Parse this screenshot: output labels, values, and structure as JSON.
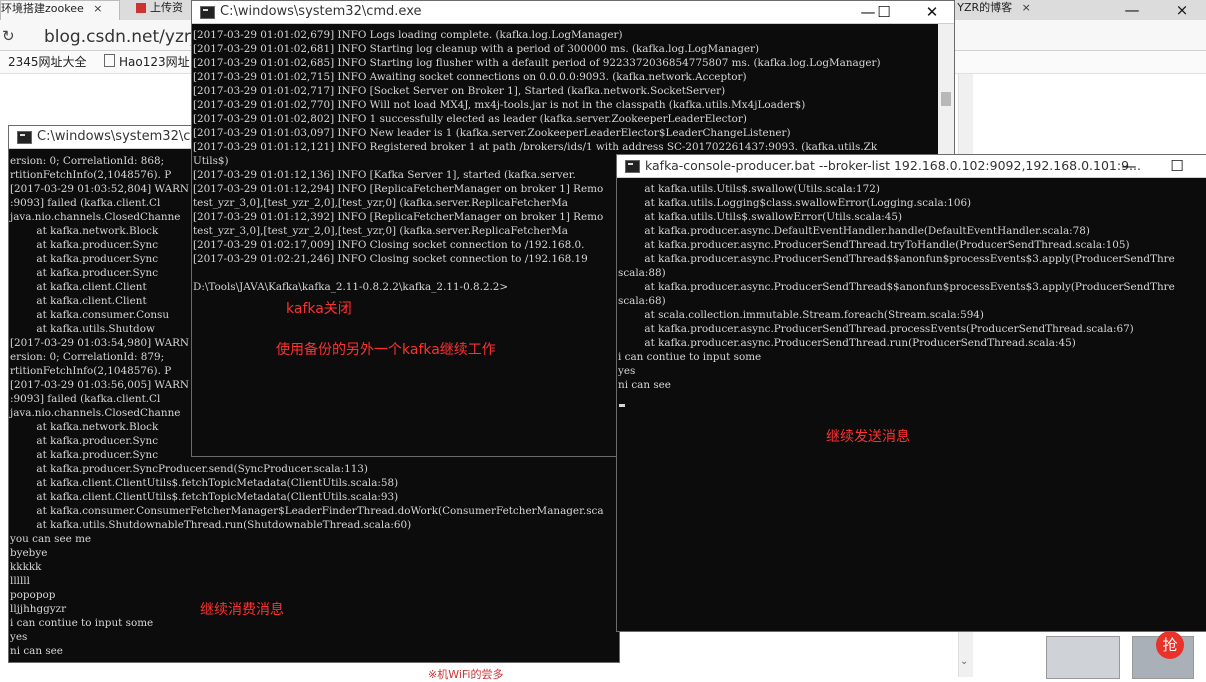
{
  "browser": {
    "tabs": [
      {
        "label": "环境搭建zookee",
        "close": "×"
      },
      {
        "label": "上传资",
        "close": ""
      },
      {
        "label": "] - YZR的博客",
        "close": "×"
      }
    ],
    "address": "blog.csdn.net/yzr_j",
    "bookmarks": [
      "2345网址大全",
      "Hao123网址"
    ],
    "window_controls": {
      "minimize": "—",
      "close": "×"
    },
    "partial_text": "※机WiFi的尝多"
  },
  "cmd_top": {
    "title": "C:\\windows\\system32\\cmd.exe",
    "controls": {
      "minimize": "—",
      "maximize": "☐",
      "close": "✕"
    },
    "lines": [
      "[2017-03-29 01:01:02,679] INFO Logs loading complete. (kafka.log.LogManager)",
      "[2017-03-29 01:01:02,681] INFO Starting log cleanup with a period of 300000 ms. (kafka.log.LogManager)",
      "[2017-03-29 01:01:02,685] INFO Starting log flusher with a default period of 9223372036854775807 ms. (kafka.log.LogManager)",
      "[2017-03-29 01:01:02,715] INFO Awaiting socket connections on 0.0.0.0:9093. (kafka.network.Acceptor)",
      "[2017-03-29 01:01:02,717] INFO [Socket Server on Broker 1], Started (kafka.network.SocketServer)",
      "[2017-03-29 01:01:02,770] INFO Will not load MX4J, mx4j-tools.jar is not in the classpath (kafka.utils.Mx4jLoader$)",
      "[2017-03-29 01:01:02,802] INFO 1 successfully elected as leader (kafka.server.ZookeeperLeaderElector)",
      "[2017-03-29 01:01:03,097] INFO New leader is 1 (kafka.server.ZookeeperLeaderElector$LeaderChangeListener)",
      "[2017-03-29 01:01:12,121] INFO Registered broker 1 at path /brokers/ids/1 with address SC-201702261437:9093. (kafka.utils.Zk",
      "Utils$)",
      "[2017-03-29 01:01:12,136] INFO [Kafka Server 1], started (kafka.server.",
      "[2017-03-29 01:01:12,294] INFO [ReplicaFetcherManager on broker 1] Remo",
      "test_yzr_3,0],[test_yzr_2,0],[test_yzr,0] (kafka.server.ReplicaFetcherMa",
      "[2017-03-29 01:01:12,392] INFO [ReplicaFetcherManager on broker 1] Remo",
      "test_yzr_3,0],[test_yzr_2,0],[test_yzr,0] (kafka.server.ReplicaFetcherMa",
      "[2017-03-29 01:02:17,009] INFO Closing socket connection to /192.168.0.",
      "[2017-03-29 01:02:21,246] INFO Closing socket connection to /192.168.19",
      "",
      "D:\\Tools\\JAVA\\Kafka\\kafka_2.11-0.8.2.2\\kafka_2.11-0.8.2.2>"
    ]
  },
  "cmd_left": {
    "title": "C:\\windows\\system32\\cmd",
    "lines": [
      "ersion: 0; CorrelationId: 868; ",
      "rtitionFetchInfo(2,1048576). P",
      "[2017-03-29 01:03:52,804] WARN",
      ":9093] failed (kafka.client.Cl",
      "java.nio.channels.ClosedChanne",
      "        at kafka.network.Block",
      "        at kafka.producer.Sync",
      "        at kafka.producer.Sync",
      "        at kafka.producer.Sync",
      "        at kafka.client.Client",
      "        at kafka.client.Client",
      "        at kafka.consumer.Consu",
      "        at kafka.utils.Shutdow",
      "[2017-03-29 01:03:54,980] WARN",
      "ersion: 0; CorrelationId: 879;",
      "rtitionFetchInfo(2,1048576). P",
      "[2017-03-29 01:03:56,005] WARN",
      ":9093] failed (kafka.client.Cl",
      "java.nio.channels.ClosedChanne",
      "        at kafka.network.Block",
      "        at kafka.producer.Sync",
      "        at kafka.producer.Sync",
      "        at kafka.producer.SyncProducer.send(SyncProducer.scala:113)",
      "        at kafka.client.ClientUtils$.fetchTopicMetadata(ClientUtils.scala:58)",
      "        at kafka.client.ClientUtils$.fetchTopicMetadata(ClientUtils.scala:93)",
      "        at kafka.consumer.ConsumerFetcherManager$LeaderFinderThread.doWork(ConsumerFetcherManager.sca",
      "        at kafka.utils.ShutdownableThread.run(ShutdownableThread.scala:60)",
      "you can see me",
      "byebye",
      "kkkkk",
      "llllll",
      "popopop",
      "lljjhhggyzr",
      "i can contiue to input some",
      "yes",
      "ni can see"
    ]
  },
  "producer": {
    "title": "kafka-console-producer.bat  --broker-list 192.168.0.102:9092,192.168.0.101:9...",
    "controls": {
      "minimize": "—",
      "maximize": "☐"
    },
    "lines": [
      "        at kafka.utils.Utils$.swallow(Utils.scala:172)",
      "        at kafka.utils.Logging$class.swallowError(Logging.scala:106)",
      "        at kafka.utils.Utils$.swallowError(Utils.scala:45)",
      "        at kafka.producer.async.DefaultEventHandler.handle(DefaultEventHandler.scala:78)",
      "        at kafka.producer.async.ProducerSendThread.tryToHandle(ProducerSendThread.scala:105)",
      "        at kafka.producer.async.ProducerSendThread$$anonfun$processEvents$3.apply(ProducerSendThre",
      "scala:88)",
      "        at kafka.producer.async.ProducerSendThread$$anonfun$processEvents$3.apply(ProducerSendThre",
      "scala:68)",
      "        at scala.collection.immutable.Stream.foreach(Stream.scala:594)",
      "        at kafka.producer.async.ProducerSendThread.processEvents(ProducerSendThread.scala:67)",
      "        at kafka.producer.async.ProducerSendThread.run(ProducerSendThread.scala:45)",
      "i can contiue to input some",
      "yes",
      "ni can see"
    ]
  },
  "annotations": {
    "kafka_closed": "kafka关闭",
    "use_backup": "使用备份的另外一个kafka继续工作",
    "continue_send": "继续发送消息",
    "continue_consume": "继续消费消息"
  },
  "badge": "抢",
  "colors": {
    "annotation": "#ff3030",
    "console_bg": "#0c0c0c",
    "console_text": "#d6d6d6"
  }
}
